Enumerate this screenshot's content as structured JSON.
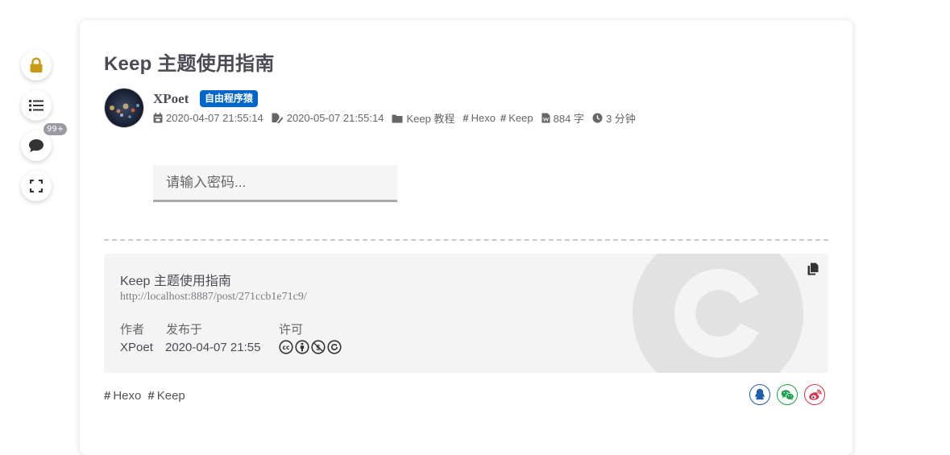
{
  "side_tools": {
    "lock_icon": "lock-icon",
    "toc_icon": "list-icon",
    "comment_icon": "comment-icon",
    "comment_badge": "99+",
    "fullscreen_icon": "expand-icon"
  },
  "post": {
    "title": "Keep 主题使用指南",
    "author": {
      "name": "XPoet",
      "label": "自由程序猿"
    },
    "meta": {
      "created": "2020-04-07 21:55:14",
      "updated": "2020-05-07 21:55:14",
      "category": "Keep 教程",
      "tags": [
        "Hexo",
        "Keep"
      ],
      "word_count": "884 字",
      "reading_time": "3 分钟"
    },
    "password": {
      "placeholder": "请输入密码...",
      "value": ""
    }
  },
  "copyright": {
    "title": "Keep 主题使用指南",
    "link": "http://localhost:8887/post/271ccb1e71c9/",
    "labels": {
      "author": "作者",
      "published": "发布于",
      "license": "许可"
    },
    "values": {
      "author": "XPoet",
      "published": "2020-04-07 21:55"
    },
    "license_icons": [
      "cc-icon",
      "by-icon",
      "nc-icon",
      "sa-icon"
    ]
  },
  "footer": {
    "tags": [
      "Hexo",
      "Keep"
    ],
    "share_icons": [
      "qq-icon",
      "wechat-icon",
      "weibo-icon"
    ]
  },
  "colors": {
    "lock": "#c69a16",
    "author_label_bg": "#0066cc",
    "qq": "#1f5fa8",
    "wechat": "#1aa34a",
    "weibo": "#d9314c"
  }
}
